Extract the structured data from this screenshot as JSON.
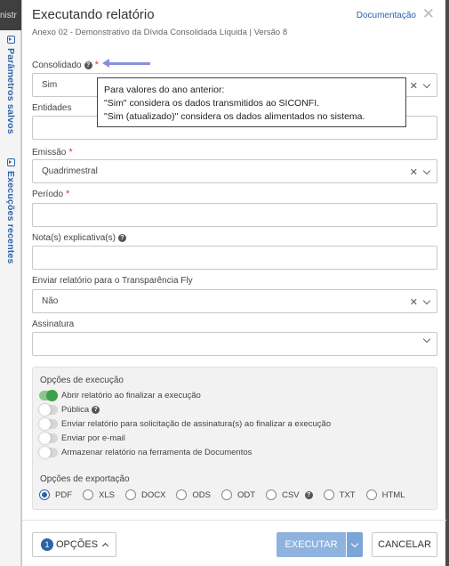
{
  "background": {
    "top_text": "nistr"
  },
  "side_tabs": [
    {
      "label": "Parâmetros salvos"
    },
    {
      "label": "Execuções recentes"
    }
  ],
  "dialog": {
    "title": "Executando relatório",
    "subtitle": "Anexo 02 - Demonstrativo da Dívida Consolidada Líquida | Versão 8",
    "doc_link": "Documentação",
    "close_glyph": "✕"
  },
  "fields": {
    "consolidado": {
      "label": "Consolidado",
      "value": "Sim",
      "required": true,
      "help": true
    },
    "entidades": {
      "label": "Entidades",
      "value": ""
    },
    "emissao": {
      "label": "Emissão",
      "value": "Quadrimestral",
      "required": true
    },
    "periodo": {
      "label": "Período",
      "value": "",
      "required": true
    },
    "notas": {
      "label": "Nota(s) explicativa(s)",
      "value": "",
      "help": true
    },
    "transparencia": {
      "label": "Enviar relatório para o Transparência Fly",
      "value": "Não"
    },
    "assinatura": {
      "label": "Assinatura",
      "value": ""
    }
  },
  "tooltip": {
    "line1": "Para valores do ano anterior:",
    "line2": "\"Sim\" considera os dados transmitidos ao SICONFI.",
    "line3": "\"Sim (atualizado)\" considera os dados alimentados no sistema."
  },
  "execution_options": {
    "title": "Opções de execução",
    "items": [
      {
        "label": "Abrir relatório ao finalizar a execução",
        "on": true
      },
      {
        "label": "Pública",
        "on": false,
        "help": true
      },
      {
        "label": "Enviar relatório para solicitação de assinatura(s) ao finalizar a execução",
        "on": false
      },
      {
        "label": "Enviar por e-mail",
        "on": false
      },
      {
        "label": "Armazenar relatório na ferramenta de Documentos",
        "on": false
      }
    ]
  },
  "export_options": {
    "title": "Opções de exportação",
    "formats": [
      "PDF",
      "XLS",
      "DOCX",
      "ODS",
      "ODT",
      "CSV",
      "TXT",
      "HTML"
    ],
    "selected": "PDF"
  },
  "footer": {
    "options_badge": "1",
    "options_label": "OPÇÕES",
    "execute_label": "EXECUTAR",
    "cancel_label": "CANCELAR"
  },
  "colors": {
    "accent": "#2a63a8",
    "toggle_on": "#3aa14a",
    "required": "#dd3333",
    "execute_bg": "#8fb3de"
  },
  "clear_glyph": "✕",
  "help_glyph": "?"
}
